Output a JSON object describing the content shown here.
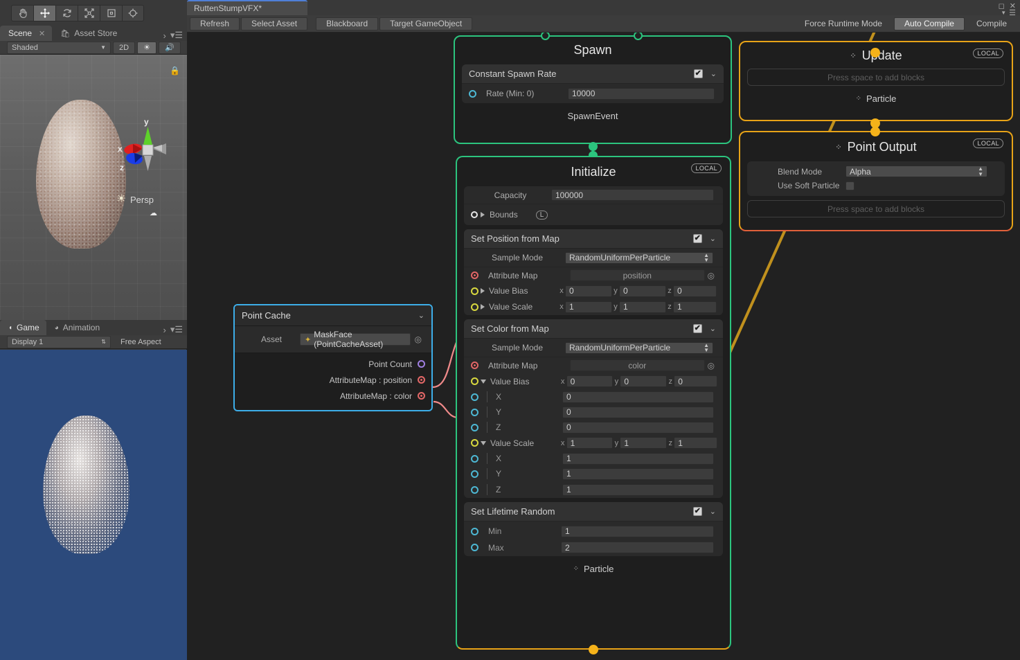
{
  "window": {
    "vfx_tab_title": "RuttenStumpVFX*",
    "win_buttons": [
      "maximize-icon",
      "close-icon",
      "menu-icon"
    ]
  },
  "unity_tools": [
    {
      "name": "hand-tool",
      "icon": "hand-icon",
      "active": false
    },
    {
      "name": "move-tool",
      "icon": "move-icon",
      "active": true
    },
    {
      "name": "rotate-tool",
      "icon": "rotate-icon",
      "active": false
    },
    {
      "name": "scale-tool",
      "icon": "scale-icon",
      "active": false
    },
    {
      "name": "rect-tool",
      "icon": "rect-icon",
      "active": false
    },
    {
      "name": "transform-tool",
      "icon": "transform-icon",
      "active": false
    }
  ],
  "scene_panel": {
    "tabs": [
      {
        "label": "Scene",
        "active": true,
        "closable": true
      },
      {
        "label": "Asset Store",
        "active": false,
        "icon": "store-icon"
      }
    ],
    "controls": {
      "shading_mode": "Shaded",
      "mode_2d": "2D",
      "lighting_icon": "sun-icon",
      "audio_icon": "speaker-icon"
    },
    "viewport": {
      "camera_label": "Persp",
      "gizmo_axes": [
        "y",
        "x",
        "z"
      ],
      "lock_icon": "lock-icon"
    }
  },
  "game_panel": {
    "tabs": [
      {
        "label": "Game",
        "active": true,
        "icon": "game-icon"
      },
      {
        "label": "Animation",
        "active": false,
        "icon": "animation-icon"
      }
    ],
    "controls": {
      "display": "Display 1",
      "aspect": "Free Aspect"
    }
  },
  "vfx_toolbar": {
    "left_buttons": [
      "Refresh",
      "Select Asset",
      "Blackboard",
      "Target GameObject"
    ],
    "right_buttons": [
      {
        "label": "Force Runtime Mode",
        "pressed": false
      },
      {
        "label": "Auto Compile",
        "pressed": true
      },
      {
        "label": "Compile",
        "pressed": false
      }
    ]
  },
  "colors": {
    "context_green": "#2cc47e",
    "context_orange": "#e8a317",
    "operator_blue": "#3daee9",
    "port_red": "#e06666",
    "port_yellow": "#d9d93f",
    "port_cyan": "#4db8d4",
    "port_purple": "#9f7fe0",
    "edge_orange": "#f5b21a",
    "edge_pink": "#f08a8a",
    "canvas_bg": "#212121"
  },
  "graph": {
    "spawn": {
      "title": "Spawn",
      "blocks": [
        {
          "title": "Constant Spawn Rate",
          "enabled": true,
          "rows": [
            {
              "port": "cyan",
              "label": "Rate (Min: 0)",
              "value": "10000"
            }
          ]
        }
      ],
      "flow_out_label": "SpawnEvent"
    },
    "initialize": {
      "title": "Initialize",
      "badge": "LOCAL",
      "settings": [
        {
          "label": "Capacity",
          "value": "100000"
        },
        {
          "label": "Bounds",
          "value": "L",
          "port": "white",
          "expandable": true
        }
      ],
      "blocks": [
        {
          "title": "Set Position from Map",
          "enabled": true,
          "sample_mode_label": "Sample Mode",
          "sample_mode_value": "RandomUniformPerParticle",
          "attribute_map_label": "Attribute Map",
          "attribute_map_value": "position",
          "vectors": [
            {
              "label": "Value Bias",
              "expanded": false,
              "x": "0",
              "y": "0",
              "z": "0"
            },
            {
              "label": "Value Scale",
              "expanded": false,
              "x": "1",
              "y": "1",
              "z": "1"
            }
          ]
        },
        {
          "title": "Set Color from Map",
          "enabled": true,
          "sample_mode_label": "Sample Mode",
          "sample_mode_value": "RandomUniformPerParticle",
          "attribute_map_label": "Attribute Map",
          "attribute_map_value": "color",
          "vectors": [
            {
              "label": "Value Bias",
              "expanded": true,
              "x": "0",
              "y": "0",
              "z": "0",
              "children": [
                {
                  "label": "X",
                  "value": "0"
                },
                {
                  "label": "Y",
                  "value": "0"
                },
                {
                  "label": "Z",
                  "value": "0"
                }
              ]
            },
            {
              "label": "Value Scale",
              "expanded": true,
              "x": "1",
              "y": "1",
              "z": "1",
              "children": [
                {
                  "label": "X",
                  "value": "1"
                },
                {
                  "label": "Y",
                  "value": "1"
                },
                {
                  "label": "Z",
                  "value": "1"
                }
              ]
            }
          ]
        },
        {
          "title": "Set Lifetime Random",
          "enabled": true,
          "rows": [
            {
              "port": "cyan",
              "label": "Min",
              "value": "1"
            },
            {
              "port": "cyan",
              "label": "Max",
              "value": "2"
            }
          ]
        }
      ],
      "flow_out_label": "Particle"
    },
    "update": {
      "title": "Update",
      "badge": "LOCAL",
      "add_blocks_hint": "Press space to add blocks",
      "flow_out_label": "Particle"
    },
    "point_output": {
      "title": "Point Output",
      "badge": "LOCAL",
      "settings": [
        {
          "label": "Blend Mode",
          "value": "Alpha",
          "type": "dropdown"
        },
        {
          "label": "Use Soft Particle",
          "value": false,
          "type": "checkbox"
        }
      ],
      "add_blocks_hint": "Press space to add blocks"
    },
    "point_cache": {
      "title": "Point Cache",
      "asset_label": "Asset",
      "asset_value": "MaskFace (PointCacheAsset)",
      "outputs": [
        {
          "label": "Point Count",
          "port": "purple"
        },
        {
          "label": "AttributeMap : position",
          "port": "red"
        },
        {
          "label": "AttributeMap : color",
          "port": "red"
        }
      ]
    }
  }
}
